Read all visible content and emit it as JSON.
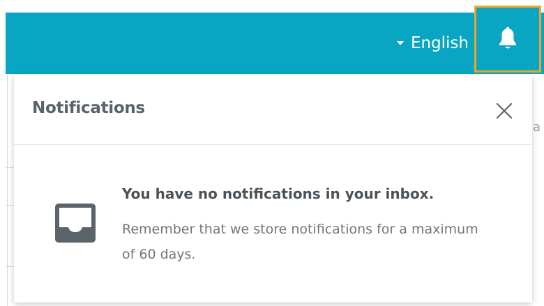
{
  "topbar": {
    "language_label": "English",
    "bell_icon": "bell-icon",
    "caret_icon": "caret-down-icon"
  },
  "notifications": {
    "title": "Notifications",
    "close_icon": "close-icon",
    "empty_icon": "inbox-icon",
    "empty_title": "You have no notifications in your inbox.",
    "empty_message": "Remember that we store notifications for a maximum of 60 days."
  },
  "colors": {
    "topbar": "#09a6c3",
    "focus_outline": "#f0a42b",
    "title_text": "#5a6268",
    "body_text": "#6e767c",
    "icon": "#5b646b"
  }
}
